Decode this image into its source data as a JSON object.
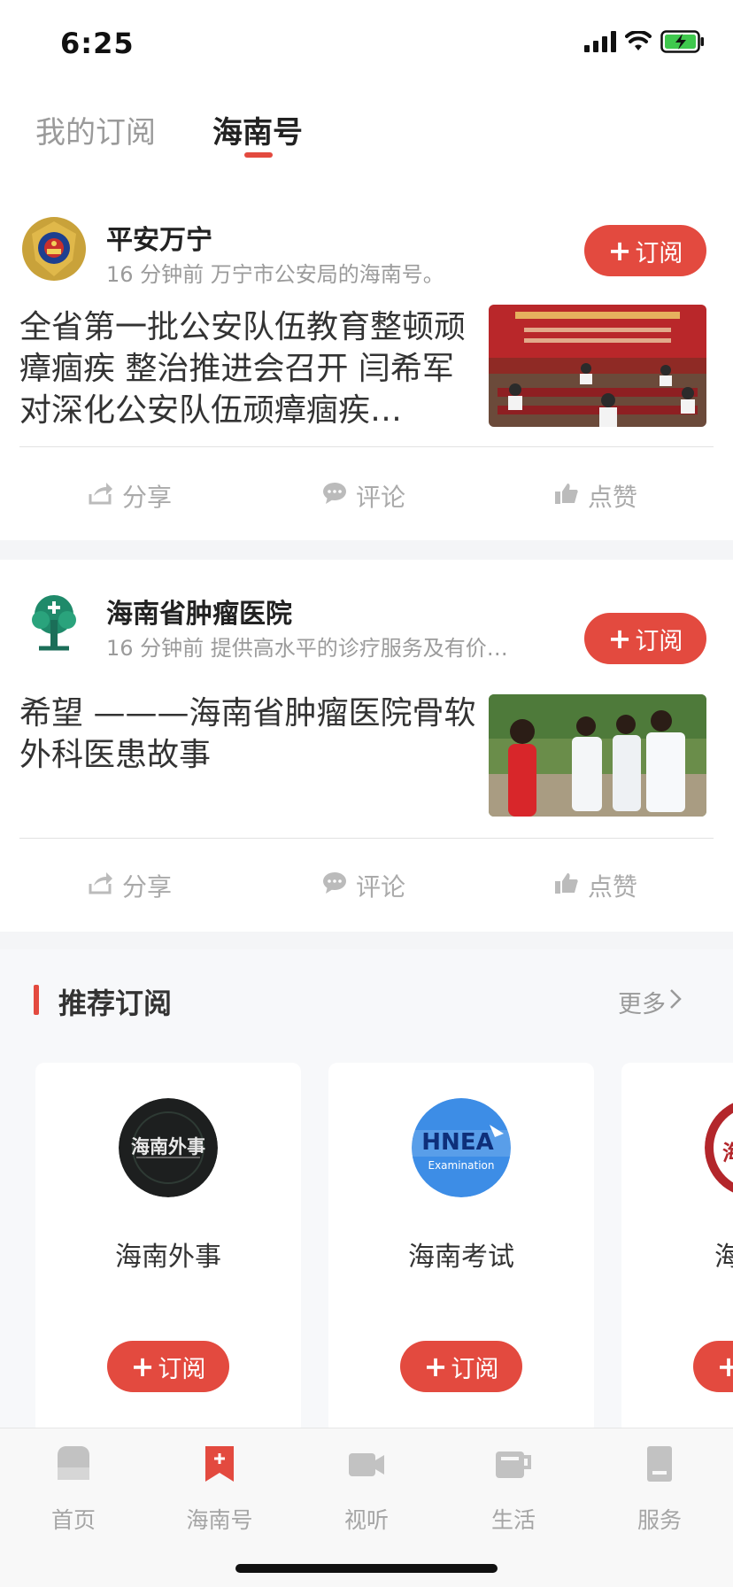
{
  "status": {
    "time": "6:25"
  },
  "tabs": [
    {
      "label": "我的订阅",
      "active": false
    },
    {
      "label": "海南号",
      "active": true
    }
  ],
  "posts": [
    {
      "account": "平安万宁",
      "meta": "16 分钟前 万宁市公安局的海南号。",
      "subscribe_label": "订阅",
      "headline": "全省第一批公安队伍教育整顿顽瘴痼疾 整治推进会召开 闫希军对深化公安队伍顽瘴痼疾…",
      "actions": [
        "分享",
        "评论",
        "点赞"
      ]
    },
    {
      "account": "海南省肿瘤医院",
      "meta": "16 分钟前 提供高水平的诊疗服务及有价…",
      "subscribe_label": "订阅",
      "headline": "希望 ———海南省肿瘤医院骨软外科医患故事",
      "actions": [
        "分享",
        "评论",
        "点赞"
      ]
    }
  ],
  "recommend": {
    "title": "推荐订阅",
    "more": "更多",
    "items": [
      {
        "name": "海南外事",
        "logo_text": "海南外事",
        "button": "订阅"
      },
      {
        "name": "海南考试",
        "logo_text": "HNEA",
        "logo_sub": "Examination",
        "button": "订阅"
      },
      {
        "name": "海南省",
        "logo_text": "海退事",
        "button": "订阅"
      }
    ]
  },
  "nav": [
    {
      "label": "首页",
      "icon": "home-icon",
      "active": false
    },
    {
      "label": "海南号",
      "icon": "bookmark-icon",
      "active": true
    },
    {
      "label": "视听",
      "icon": "video-icon",
      "active": false
    },
    {
      "label": "生活",
      "icon": "coffee-cup-icon",
      "active": false
    },
    {
      "label": "服务",
      "icon": "book-icon",
      "active": false
    }
  ],
  "colors": {
    "accent": "#e34a3f",
    "muted": "#a5a5a5"
  }
}
